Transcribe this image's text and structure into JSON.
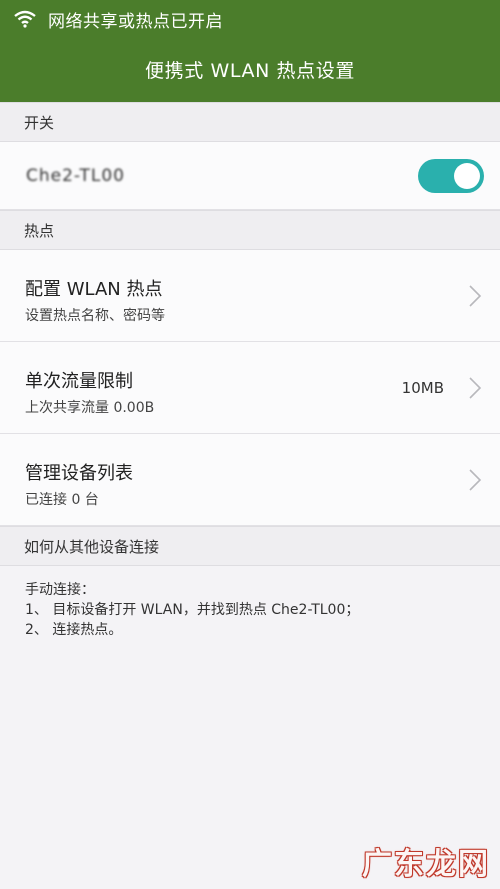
{
  "status_bar": {
    "notification_text": "网络共享或热点已开启",
    "icon": "wifi-hotspot-icon"
  },
  "header": {
    "title": "便携式 WLAN 热点设置",
    "color": "#4b7d2b"
  },
  "sections": {
    "switch": {
      "header": "开关",
      "label": "Che2-TL00",
      "toggle_on": true,
      "toggle_color": "#2ab0ad"
    },
    "hotspot": {
      "header": "热点",
      "items": [
        {
          "title": "配置 WLAN 热点",
          "subtitle": "设置热点名称、密码等",
          "value": ""
        },
        {
          "title": "单次流量限制",
          "subtitle": "上次共享流量 0.00B",
          "value": "10MB"
        },
        {
          "title": "管理设备列表",
          "subtitle": "已连接 0 台",
          "value": ""
        }
      ]
    },
    "connect": {
      "header": "如何从其他设备连接",
      "lines": [
        "手动连接：",
        "1、 目标设备打开 WLAN，并找到热点 Che2-TL00；",
        "2、 连接热点。"
      ]
    }
  },
  "watermark": "广东龙网"
}
